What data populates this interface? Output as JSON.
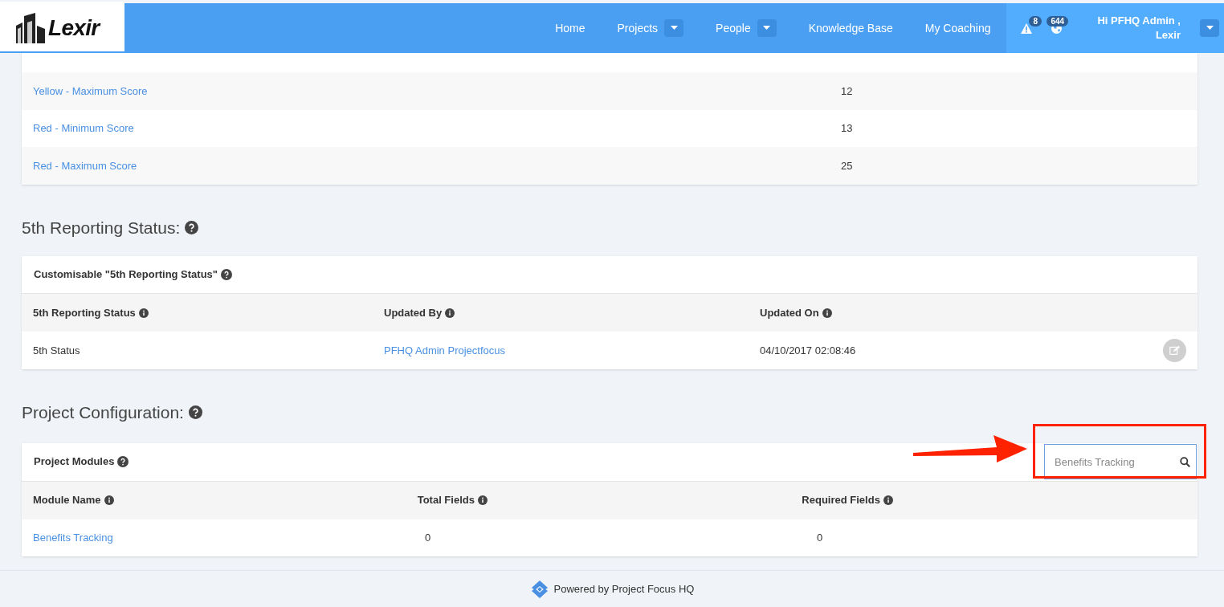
{
  "nav": {
    "logo": "Lexir",
    "items": [
      {
        "label": "Home",
        "dropdown": false
      },
      {
        "label": "Projects",
        "dropdown": true
      },
      {
        "label": "People",
        "dropdown": true
      },
      {
        "label": "Knowledge Base",
        "dropdown": false
      },
      {
        "label": "My Coaching",
        "dropdown": false
      }
    ],
    "alerts_count": "8",
    "globe_count": "644",
    "user_line1": "Hi PFHQ Admin ,",
    "user_line2": "Lexir"
  },
  "score_table": {
    "rows": [
      {
        "label": "Yellow - Maximum Score",
        "value": "12"
      },
      {
        "label": "Red - Minimum Score",
        "value": "13"
      },
      {
        "label": "Red - Maximum Score",
        "value": "25"
      }
    ]
  },
  "reporting": {
    "heading": "5th Reporting Status:",
    "card_title": "Customisable \"5th Reporting Status\"",
    "columns": [
      "5th Reporting Status",
      "Updated By",
      "Updated On"
    ],
    "rows": [
      {
        "status": "5th Status",
        "updated_by": "PFHQ Admin Projectfocus",
        "updated_on": "04/10/2017 02:08:46"
      }
    ]
  },
  "configuration": {
    "heading": "Project Configuration:",
    "card_title": "Project Modules",
    "search_value": "Benefits Tracking",
    "columns": [
      "Module Name",
      "Total Fields",
      "Required Fields"
    ],
    "rows": [
      {
        "name": "Benefits Tracking",
        "total": "0",
        "required": "0"
      }
    ]
  },
  "footer": {
    "text": "Powered by Project Focus HQ"
  }
}
